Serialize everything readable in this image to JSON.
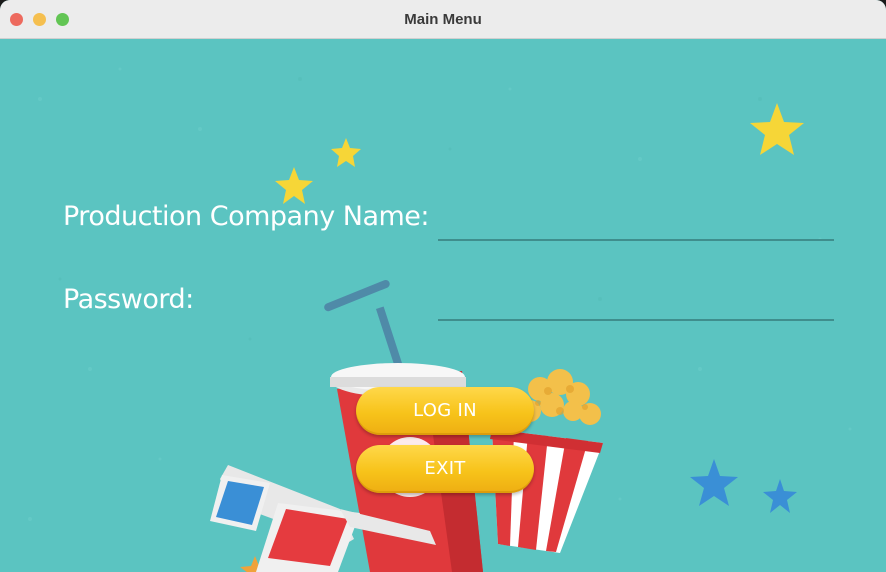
{
  "window": {
    "title": "Main Menu"
  },
  "form": {
    "company_label": "Production Company Name:",
    "company_value": "",
    "password_label": "Password:",
    "password_value": ""
  },
  "buttons": {
    "login_label": "LOG IN",
    "exit_label": "EXIT"
  },
  "colors": {
    "background": "#5bc4c1",
    "button": "#f7c31a",
    "star_yellow": "#f6d637",
    "star_blue": "#3a8fd6",
    "cup_red": "#e0393c"
  },
  "icons": [
    "close-icon",
    "minimize-icon",
    "maximize-icon",
    "star-icon",
    "drink-cup-icon",
    "popcorn-icon",
    "3d-glasses-icon"
  ]
}
